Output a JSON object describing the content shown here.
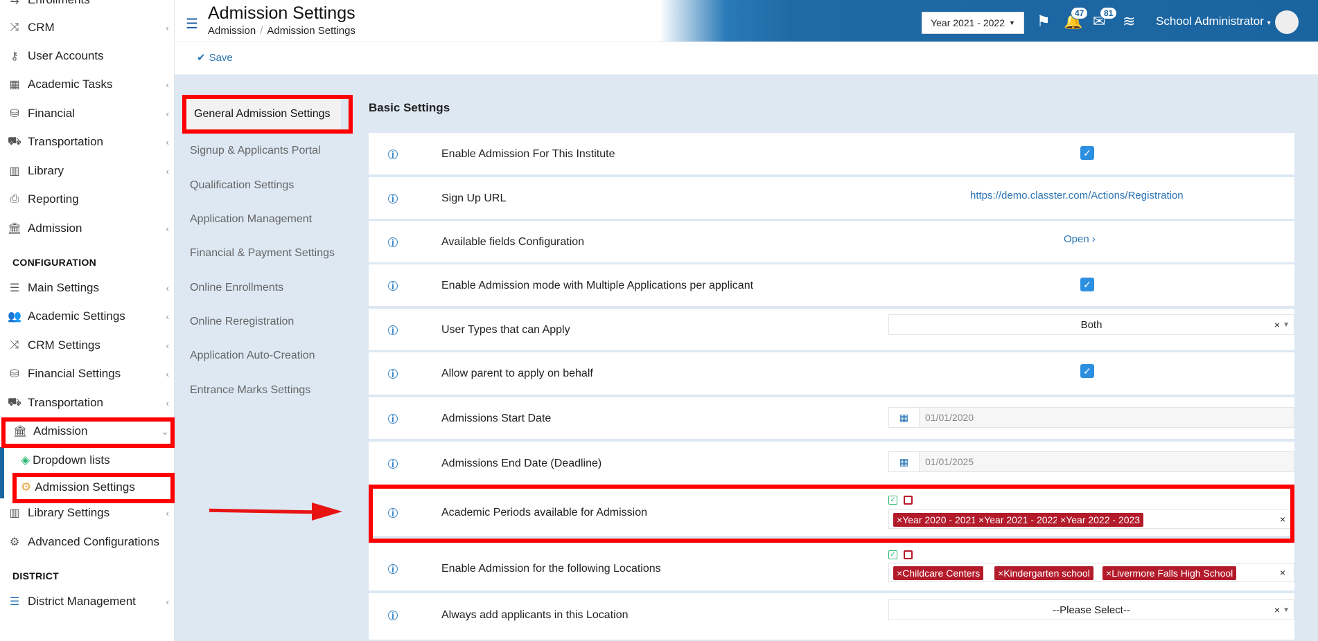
{
  "sidebar": {
    "items": [
      {
        "label": "Enrollments",
        "icon": "enrollments-icon"
      },
      {
        "label": "CRM",
        "icon": "crm-icon"
      },
      {
        "label": "User Accounts",
        "icon": "key-icon"
      },
      {
        "label": "Academic Tasks",
        "icon": "tasks-icon"
      },
      {
        "label": "Financial",
        "icon": "coins-icon"
      },
      {
        "label": "Transportation",
        "icon": "bus-icon"
      },
      {
        "label": "Library",
        "icon": "books-icon"
      },
      {
        "label": "Reporting",
        "icon": "printer-icon"
      },
      {
        "label": "Admission",
        "icon": "institution-icon"
      }
    ],
    "config_section": "CONFIGURATION",
    "config_items": [
      {
        "label": "Main Settings",
        "icon": "sliders-icon"
      },
      {
        "label": "Academic Settings",
        "icon": "users-icon"
      },
      {
        "label": "CRM Settings",
        "icon": "crm-icon"
      },
      {
        "label": "Financial Settings",
        "icon": "coins-icon"
      },
      {
        "label": "Transportation",
        "icon": "bus-icon"
      },
      {
        "label": "Admission",
        "icon": "institution-icon"
      },
      {
        "label": "Library Settings",
        "icon": "books-icon"
      },
      {
        "label": "Advanced Configurations",
        "icon": "gears-icon"
      }
    ],
    "admission_sub": [
      "Dropdown lists",
      "Admission Settings"
    ],
    "district_section": "DISTRICT",
    "district_items": [
      {
        "label": "District Management",
        "icon": "list-icon"
      }
    ]
  },
  "header": {
    "title": "Admission Settings",
    "breadcrumb": [
      "Admission",
      "Admission Settings"
    ],
    "year": "Year 2021 - 2022",
    "notifications": "47",
    "messages": "81",
    "user": "School Administrator"
  },
  "toolbar": {
    "save_label": "Save"
  },
  "tabs": [
    "General Admission Settings",
    "Signup & Applicants Portal",
    "Qualification Settings",
    "Application Management",
    "Financial & Payment Settings",
    "Online Enrollments",
    "Online Reregistration",
    "Application Auto-Creation",
    "Entrance Marks Settings"
  ],
  "section_title": "Basic Settings",
  "settings": {
    "enable_admission": "Enable Admission For This Institute",
    "signup_url_label": "Sign Up URL",
    "signup_url": "https://demo.classter.com/Actions/Registration",
    "fields_config": "Available fields Configuration",
    "open_label": "Open",
    "multi_app": "Enable Admission mode with Multiple Applications per applicant",
    "user_types": "User Types that can Apply",
    "user_types_value": "Both",
    "parent_apply": "Allow parent to apply on behalf",
    "start_date_label": "Admissions Start Date",
    "start_date": "01/01/2020",
    "end_date_label": "Admissions End Date (Deadline)",
    "end_date": "01/01/2025",
    "periods_label": "Academic Periods available for Admission",
    "periods": [
      "Year 2020 - 2021",
      "Year 2021 - 2022",
      "Year 2022 - 2023"
    ],
    "locations_label": "Enable Admission for the following Locations",
    "locations": [
      "Childcare Centers",
      "Kindergarten school",
      "Livermore Falls High School"
    ],
    "always_add_label": "Always add applicants in this Location",
    "always_add_value": "--Please Select--"
  },
  "colors": {
    "accent": "#1a64a0",
    "tag": "#b31b2b",
    "highlight": "#ff0000",
    "checkbox": "#2d8fe0"
  }
}
